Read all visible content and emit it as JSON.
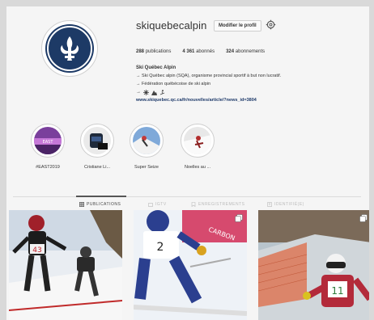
{
  "profile": {
    "username": "skiquebecalpin",
    "edit_label": "Modifier le profil",
    "stats": {
      "publications_count": "288",
      "publications_label": "publications",
      "abonnes_count": "4 361",
      "abonnes_label": "abonnés",
      "abonnements_count": "324",
      "abonnements_label": "abonnements"
    },
    "bio": {
      "name": "Ski Québec Alpin",
      "line1": "→ Ski Québec alpin (SQA), organisme provincial sportif à but non lucratif.",
      "line2": "→ Fédération québécoise de ski alpin",
      "link": "www.skiquebec.qc.ca/fr/nouvelles/article/?news_id=3804"
    }
  },
  "highlights": [
    {
      "label": "#EAST2019"
    },
    {
      "label": "Cristiane Li..."
    },
    {
      "label": "Super Seize"
    },
    {
      "label": "Noelles au ..."
    }
  ],
  "tabs": [
    {
      "label": "PUBLICATIONS",
      "active": true
    },
    {
      "label": "IGTV",
      "active": false
    },
    {
      "label": "ENREGISTREMENTS",
      "active": false
    },
    {
      "label": "IDENTIFIÉ(E)",
      "active": false
    }
  ],
  "posts": [
    {
      "bib": "43",
      "icon": "none"
    },
    {
      "bib": "2",
      "icon": "multi-icon"
    },
    {
      "bib": "11",
      "icon": "multi-icon"
    }
  ],
  "icons": {
    "settings": "gear-icon",
    "bio_emoji": [
      "snowflake-icon",
      "mountain-icon",
      "skier-icon"
    ]
  },
  "colors": {
    "brand_navy": "#1d3a66",
    "link": "#1e3a6a",
    "background": "#f5f5f5"
  }
}
